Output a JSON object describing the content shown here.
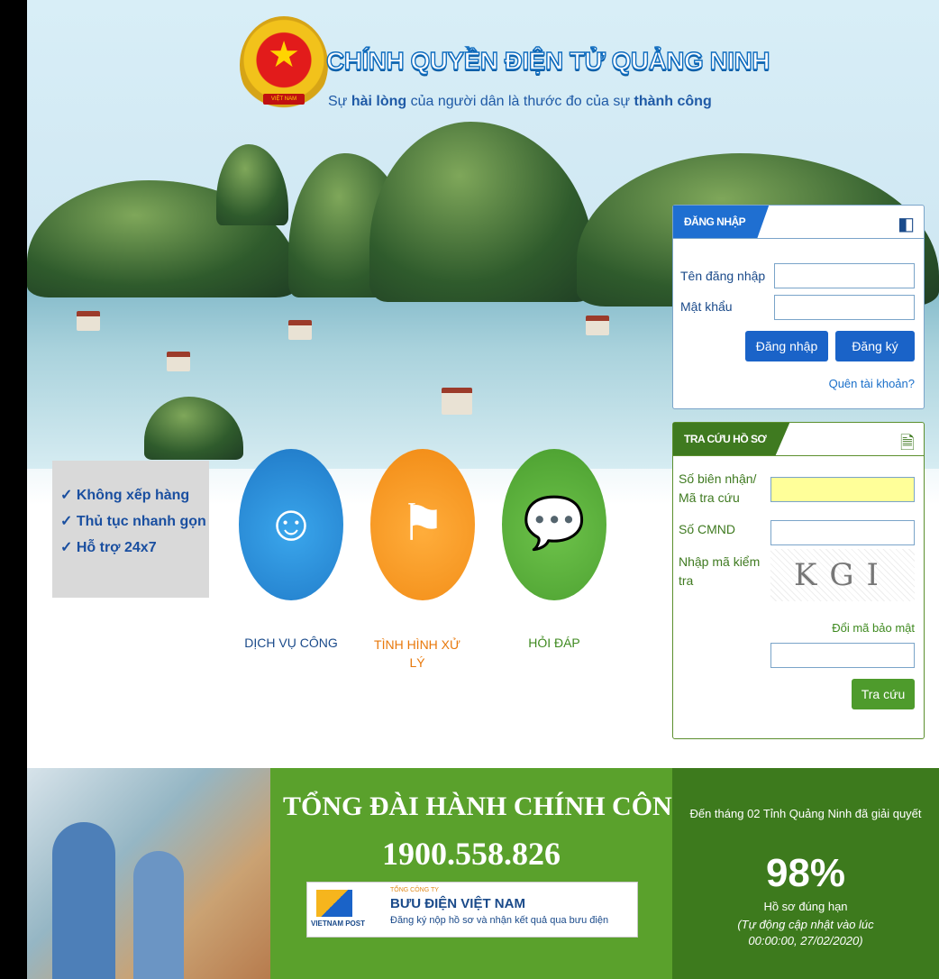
{
  "header": {
    "title": "CHÍNH QUYỀN ĐIỆN TỬ QUẢNG NINH",
    "slogan_1": "Sự ",
    "slogan_2": "hài lòng",
    "slogan_3": " của người dân là thước đo của sự ",
    "slogan_4": "thành công",
    "emblem_text": "VIỆT NAM"
  },
  "features": [
    "✓ Không xếp hàng",
    "✓ Thủ tục nhanh gọn",
    "✓ Hỗ trợ 24x7"
  ],
  "services": [
    {
      "label": "DỊCH VỤ CÔNG",
      "color": "#1f78c6"
    },
    {
      "label": "TÌNH HÌNH XỬ LÝ",
      "color": "#f18a14"
    },
    {
      "label": "HỎI ĐÁP",
      "color": "#4a9e2f"
    }
  ],
  "login": {
    "tab": "ĐĂNG NHẬP",
    "username_label": "Tên đăng nhập",
    "username_value": "",
    "password_label": "Mật khẩu",
    "password_value": "",
    "login_button": "Đăng nhập",
    "register_button": "Đăng ký",
    "forgot_link": "Quên tài khoản?"
  },
  "lookup": {
    "tab": "TRA CỨU HỒ SƠ",
    "receipt_label": "Số biên nhận/ Mã tra cứu",
    "receipt_value": "",
    "cmnd_label": "Số CMND",
    "cmnd_value": "",
    "captcha_label": "Nhập mã kiểm tra",
    "captcha_text": "KGI",
    "refresh_link": "Đổi mã bảo mật",
    "captcha_value": "",
    "submit_button": "Tra cứu"
  },
  "footer": {
    "hotline_title": "TỔNG ĐÀI HÀNH CHÍNH CÔNG",
    "hotline_number": "1900.558.826",
    "post_small": "TỔNG CÔNG TY",
    "post_name": "BƯU ĐIỆN VIỆT NAM",
    "post_logo_text": "VIETNAM POST",
    "post_desc": "Đăng ký nộp hồ sơ và nhận kết quả qua bưu điện",
    "stats_intro": "Đến tháng 02 Tỉnh Quảng Ninh đã giải quyết",
    "stats_percent": "98%",
    "stats_label": "Hồ sơ đúng hạn",
    "stats_update": "(Tự động cập nhật vào lúc",
    "stats_time": "00:00:00, 27/02/2020)"
  },
  "colors": {
    "brand_blue": "#1f6fd1",
    "green_dark": "#3d7a1d",
    "green": "#5aa12c",
    "orange": "#f18a14"
  }
}
